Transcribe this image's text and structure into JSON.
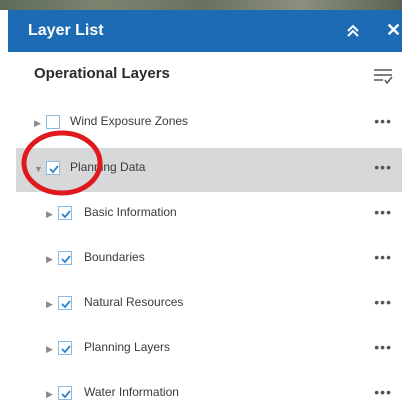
{
  "header": {
    "title": "Layer List",
    "collapse_icon": "double-chevron-up-icon",
    "close_icon": "close-icon",
    "close_glyph": "✕",
    "color": "#1d6bb4"
  },
  "panel": {
    "section_title": "Operational Layers",
    "menu_icon": "filter-list-icon"
  },
  "layers": [
    {
      "label": "Wind Exposure Zones",
      "checked": false,
      "expanded": false,
      "more": "•••"
    },
    {
      "label": "Planning Data",
      "checked": true,
      "expanded": true,
      "selected": true,
      "more": "•••"
    },
    {
      "label": "Basic Information",
      "checked": true,
      "expanded": false,
      "more": "•••"
    },
    {
      "label": "Boundaries",
      "checked": true,
      "expanded": false,
      "more": "•••"
    },
    {
      "label": "Natural Resources",
      "checked": true,
      "expanded": false,
      "more": "•••"
    },
    {
      "label": "Planning Layers",
      "checked": true,
      "expanded": false,
      "more": "•••"
    },
    {
      "label": "Water Information",
      "checked": true,
      "expanded": false,
      "more": "•••"
    }
  ]
}
